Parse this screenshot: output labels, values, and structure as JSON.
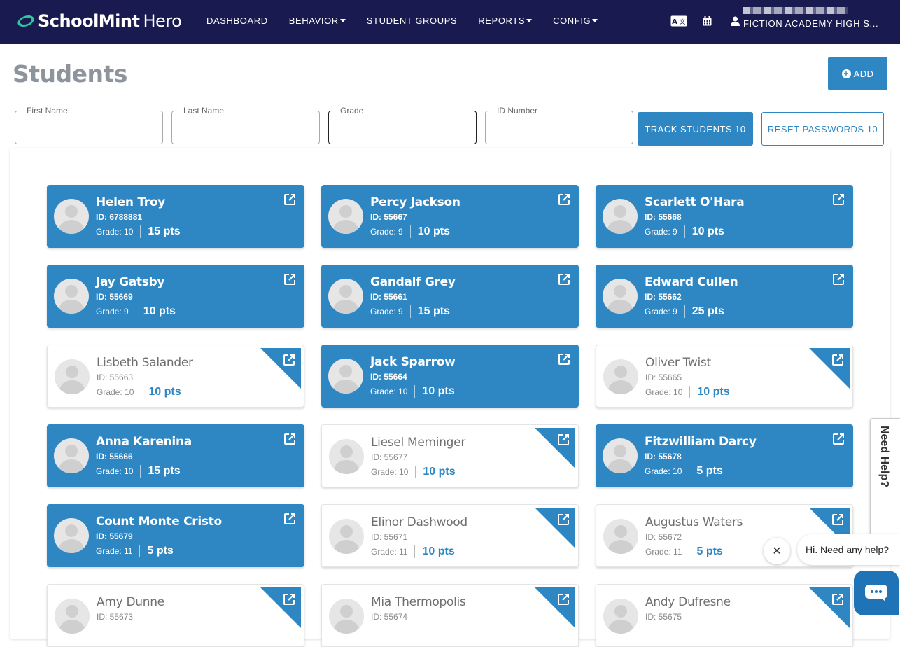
{
  "app": {
    "logo_primary": "SchoolMint",
    "logo_secondary": "Hero",
    "nav": [
      {
        "label": "DASHBOARD",
        "dropdown": false
      },
      {
        "label": "BEHAVIOR",
        "dropdown": true
      },
      {
        "label": "STUDENT GROUPS",
        "dropdown": false
      },
      {
        "label": "REPORTS",
        "dropdown": true
      },
      {
        "label": "CONFIG",
        "dropdown": true
      }
    ],
    "icons": [
      "translate-icon",
      "calendar-icon",
      "user-icon"
    ],
    "school_name": "FICTION ACADEMY HIGH S..."
  },
  "page": {
    "title": "Students",
    "add_label": "ADD"
  },
  "filters": {
    "first_name": {
      "label": "First Name",
      "value": ""
    },
    "last_name": {
      "label": "Last Name",
      "value": ""
    },
    "grade": {
      "label": "Grade",
      "value": ""
    },
    "id_number": {
      "label": "ID Number",
      "value": ""
    },
    "track_label": "TRACK STUDENTS 10",
    "reset_label": "RESET PASSWORDS 10"
  },
  "students": [
    {
      "name": "Helen Troy",
      "id": "ID: 6788881",
      "grade": "Grade: 10",
      "pts": "15 pts",
      "tracked": true
    },
    {
      "name": "Percy Jackson",
      "id": "ID: 55667",
      "grade": "Grade: 9",
      "pts": "10 pts",
      "tracked": true
    },
    {
      "name": "Scarlett O'Hara",
      "id": "ID: 55668",
      "grade": "Grade: 9",
      "pts": "10 pts",
      "tracked": true
    },
    {
      "name": "Jay Gatsby",
      "id": "ID: 55669",
      "grade": "Grade: 9",
      "pts": "10 pts",
      "tracked": true
    },
    {
      "name": "Gandalf Grey",
      "id": "ID: 55661",
      "grade": "Grade: 9",
      "pts": "15 pts",
      "tracked": true
    },
    {
      "name": "Edward Cullen",
      "id": "ID: 55662",
      "grade": "Grade: 9",
      "pts": "25 pts",
      "tracked": true
    },
    {
      "name": "Lisbeth Salander",
      "id": "ID: 55663",
      "grade": "Grade: 10",
      "pts": "10 pts",
      "tracked": false
    },
    {
      "name": "Jack Sparrow",
      "id": "ID: 55664",
      "grade": "Grade: 10",
      "pts": "10 pts",
      "tracked": true
    },
    {
      "name": "Oliver Twist",
      "id": "ID: 55665",
      "grade": "Grade: 10",
      "pts": "10 pts",
      "tracked": false
    },
    {
      "name": "Anna Karenina",
      "id": "ID: 55666",
      "grade": "Grade: 10",
      "pts": "15 pts",
      "tracked": true
    },
    {
      "name": "Liesel Meminger",
      "id": "ID: 55677",
      "grade": "Grade: 10",
      "pts": "10 pts",
      "tracked": false
    },
    {
      "name": "Fitzwilliam Darcy",
      "id": "ID: 55678",
      "grade": "Grade: 10",
      "pts": "5 pts",
      "tracked": true
    },
    {
      "name": "Count Monte Cristo",
      "id": "ID: 55679",
      "grade": "Grade: 11",
      "pts": "5 pts",
      "tracked": true
    },
    {
      "name": "Elinor Dashwood",
      "id": "ID: 55671",
      "grade": "Grade: 11",
      "pts": "10 pts",
      "tracked": false
    },
    {
      "name": "Augustus Waters",
      "id": "ID: 55672",
      "grade": "Grade: 11",
      "pts": "5 pts",
      "tracked": false
    },
    {
      "name": "Amy Dunne",
      "id": "ID: 55673",
      "grade": "",
      "pts": "",
      "tracked": false
    },
    {
      "name": "Mia Thermopolis",
      "id": "ID: 55674",
      "grade": "",
      "pts": "",
      "tracked": false
    },
    {
      "name": "Andy Dufresne",
      "id": "ID: 55675",
      "grade": "",
      "pts": "",
      "tracked": false
    }
  ],
  "help": {
    "tab_label": "Need Help?",
    "bubble_text": "Hi. Need any help?"
  },
  "colors": {
    "navbar": "#191a4f",
    "primary": "#2e87c3",
    "logo_accent": "#2fc6a0"
  }
}
